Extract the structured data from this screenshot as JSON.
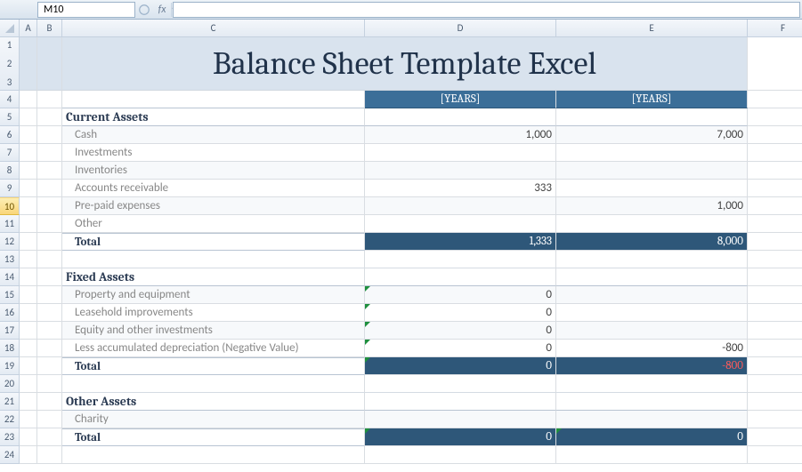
{
  "namebox": "M10",
  "formula": "",
  "columns": [
    "A",
    "B",
    "C",
    "D",
    "E",
    "F"
  ],
  "rows_count": 24,
  "selected_row": 10,
  "title": "Balance Sheet Template Excel",
  "header": {
    "col_d": "[YEARS]",
    "col_e": "[YEARS]"
  },
  "sections": {
    "current": {
      "title": "Current Assets",
      "items": [
        {
          "label": "Cash",
          "d": "1,000",
          "e": "7,000"
        },
        {
          "label": "Investments",
          "d": "",
          "e": ""
        },
        {
          "label": "Inventories",
          "d": "",
          "e": ""
        },
        {
          "label": "Accounts receivable",
          "d": "333",
          "e": ""
        },
        {
          "label": "Pre-paid expenses",
          "d": "",
          "e": "1,000"
        },
        {
          "label": "Other",
          "d": "",
          "e": ""
        }
      ],
      "total_label": "Total",
      "total_d": "1,333",
      "total_e": "8,000"
    },
    "fixed": {
      "title": "Fixed Assets",
      "items": [
        {
          "label": "Property and equipment",
          "d": "0",
          "e": ""
        },
        {
          "label": "Leasehold improvements",
          "d": "0",
          "e": ""
        },
        {
          "label": "Equity and other investments",
          "d": "0",
          "e": ""
        },
        {
          "label": "Less accumulated depreciation (Negative Value)",
          "d": "0",
          "e": "-800"
        }
      ],
      "total_label": "Total",
      "total_d": "0",
      "total_e": "-800"
    },
    "other": {
      "title": "Other Assets",
      "items": [
        {
          "label": "Charity",
          "d": "",
          "e": ""
        }
      ],
      "total_label": "Total",
      "total_d": "0",
      "total_e": "0"
    }
  }
}
